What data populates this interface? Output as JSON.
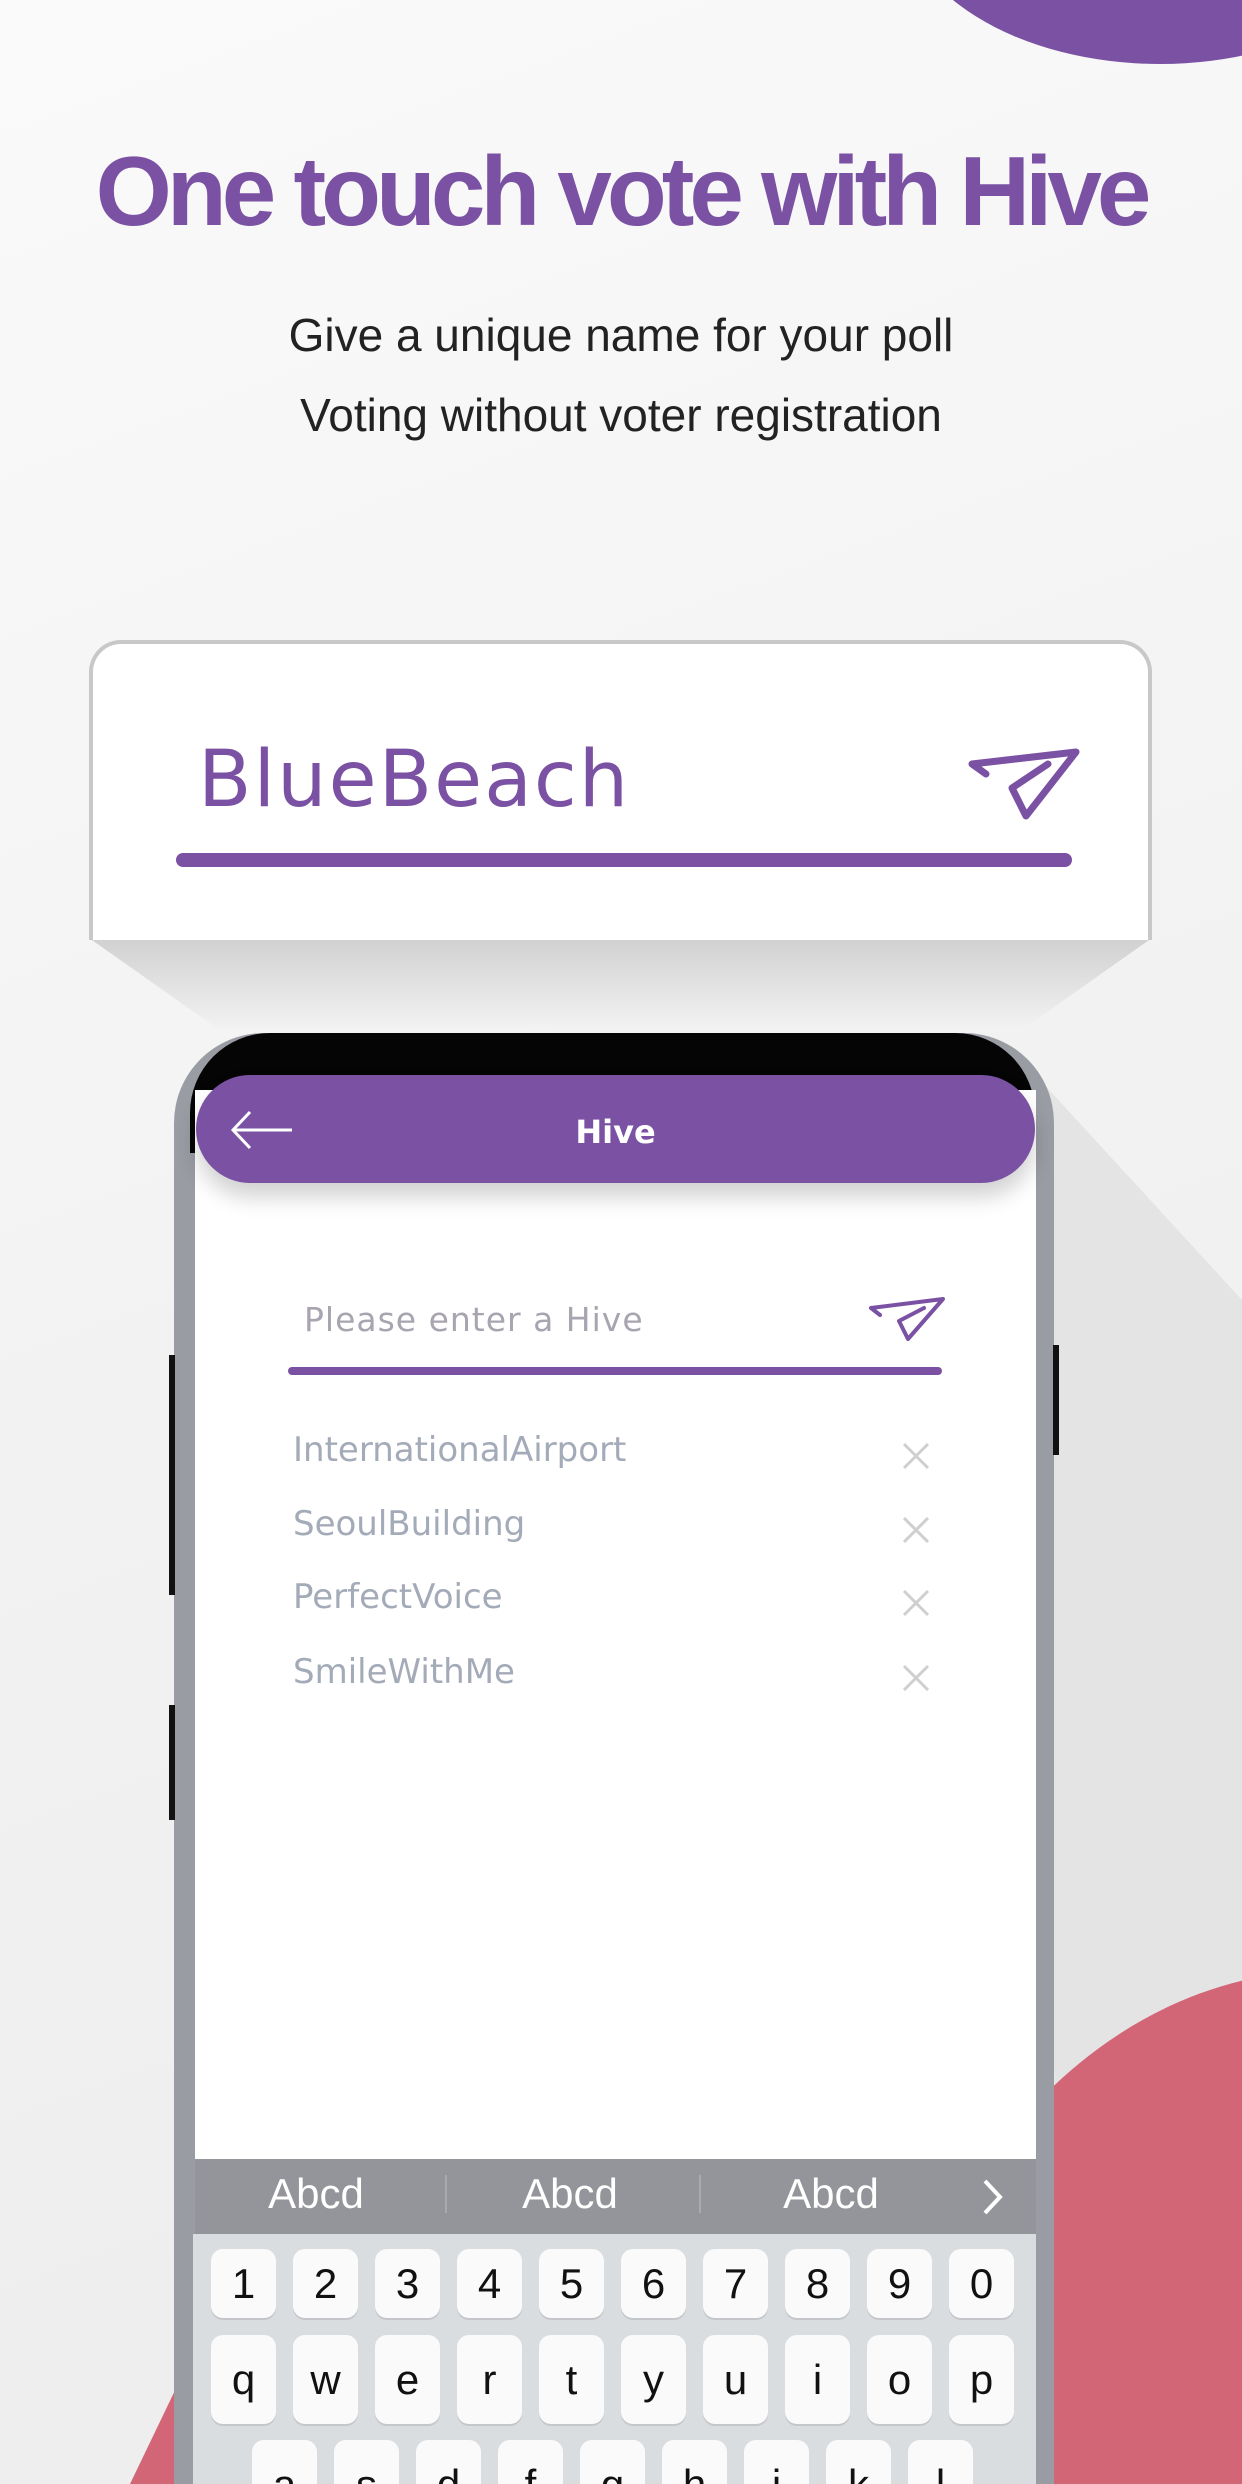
{
  "colors": {
    "accent": "#7b52a3",
    "secondary": "#d36676"
  },
  "hero": {
    "title": "One touch vote with Hive",
    "subtitle_lines": [
      "Give a unique name for your poll",
      "Voting without voter registration"
    ]
  },
  "demo_input": {
    "value": "BlueBeach",
    "icon": "send-icon"
  },
  "app": {
    "title": "Hive",
    "back_icon": "arrow-left-icon",
    "input": {
      "placeholder": "Please enter a Hive",
      "icon": "send-icon"
    },
    "recent": [
      {
        "label": "InternationalAirport"
      },
      {
        "label": "SeoulBuilding"
      },
      {
        "label": "PerfectVoice"
      },
      {
        "label": "SmileWithMe"
      }
    ]
  },
  "keyboard": {
    "suggestions": [
      "Abcd",
      "Abcd",
      "Abcd"
    ],
    "rows": [
      [
        "1",
        "2",
        "3",
        "4",
        "5",
        "6",
        "7",
        "8",
        "9",
        "0"
      ],
      [
        "q",
        "w",
        "e",
        "r",
        "t",
        "y",
        "u",
        "i",
        "o",
        "p"
      ],
      [
        "a",
        "s",
        "d",
        "f",
        "g",
        "h",
        "j",
        "k",
        "l"
      ]
    ]
  }
}
